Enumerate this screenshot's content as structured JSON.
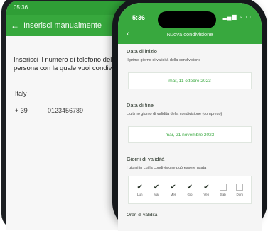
{
  "android": {
    "status_time": "05:36",
    "appbar_title": "Inserisci manualmente",
    "instruction": "Inserisci il numero di telefono della persona con la quale vuoi condividere",
    "country": "Italy",
    "prefix": "+ 39",
    "phone_placeholder": "0123456789"
  },
  "iphone": {
    "status_time": "5:36",
    "status_icons": "▂▄▆ ≈ ▭",
    "nav_title": "Nuova condivisione",
    "start": {
      "title": "Data di inizio",
      "desc": "Il primo giorno di validità della condivisione",
      "value": "mar, 11 ottobre 2023"
    },
    "end": {
      "title": "Data di fine",
      "desc": "L'ultimo giorno di validità della condivisione (compreso)",
      "value": "mar, 21 novembre 2023"
    },
    "days": {
      "title": "Giorni di validità",
      "desc": "I giorni in cui la condivisione può essere usata",
      "items": [
        {
          "label": "Lun",
          "checked": true
        },
        {
          "label": "Mar",
          "checked": true
        },
        {
          "label": "Mer",
          "checked": true
        },
        {
          "label": "Gio",
          "checked": true
        },
        {
          "label": "Ven",
          "checked": true
        },
        {
          "label": "Sab",
          "checked": false
        },
        {
          "label": "Dom",
          "checked": false
        }
      ]
    },
    "orari_title": "Orari di validità"
  },
  "colors": {
    "accent": "#38a83e",
    "accent_text": "#3daa43"
  }
}
